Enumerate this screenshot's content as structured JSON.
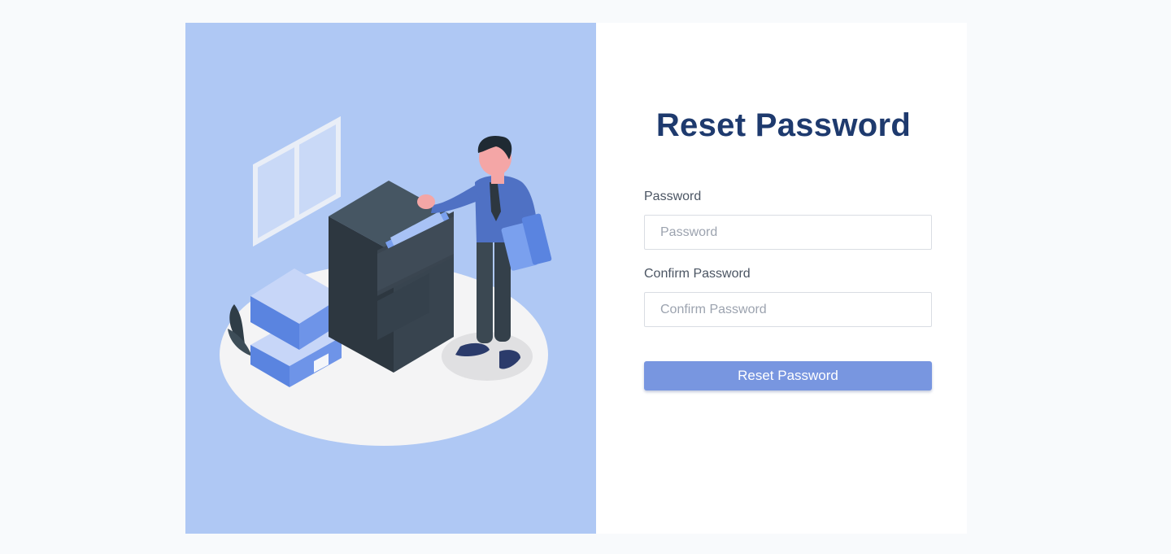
{
  "page": {
    "background": "#f8fafc"
  },
  "illustration": {
    "icon": "office-filing-cabinet-illustration",
    "background": "#afc8f4"
  },
  "form": {
    "title": "Reset Password",
    "password": {
      "label": "Password",
      "placeholder": "Password",
      "value": ""
    },
    "confirm_password": {
      "label": "Confirm Password",
      "placeholder": "Confirm Password",
      "value": ""
    },
    "submit_label": "Reset Password",
    "colors": {
      "title": "#1e3a6e",
      "button": "#7896e0"
    }
  }
}
